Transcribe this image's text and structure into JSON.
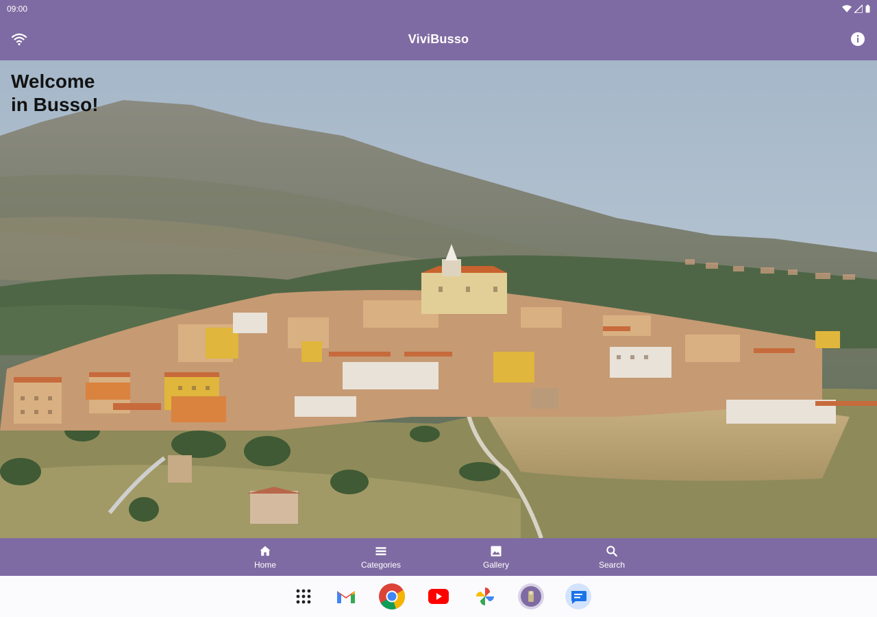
{
  "status_bar": {
    "time": "09:00"
  },
  "app_bar": {
    "title": "ViviBusso",
    "left_icon": "wifi-icon",
    "right_icon": "info-icon"
  },
  "hero": {
    "welcome_text": "Welcome\nin Busso!",
    "image": "busso-village-landscape"
  },
  "bottom_nav": {
    "items": [
      {
        "label": "Home",
        "icon": "home-icon"
      },
      {
        "label": "Categories",
        "icon": "list-icon"
      },
      {
        "label": "Gallery",
        "icon": "image-icon"
      },
      {
        "label": "Search",
        "icon": "search-icon"
      }
    ]
  },
  "dock": {
    "apps": [
      "app-drawer-icon",
      "gmail-icon",
      "chrome-icon",
      "youtube-icon",
      "photos-icon",
      "vivibusso-app-icon",
      "messages-icon"
    ]
  },
  "colors": {
    "primary": "#7f6ba3",
    "on_primary": "#ffffff",
    "dock_background": "#fbfbfd"
  }
}
